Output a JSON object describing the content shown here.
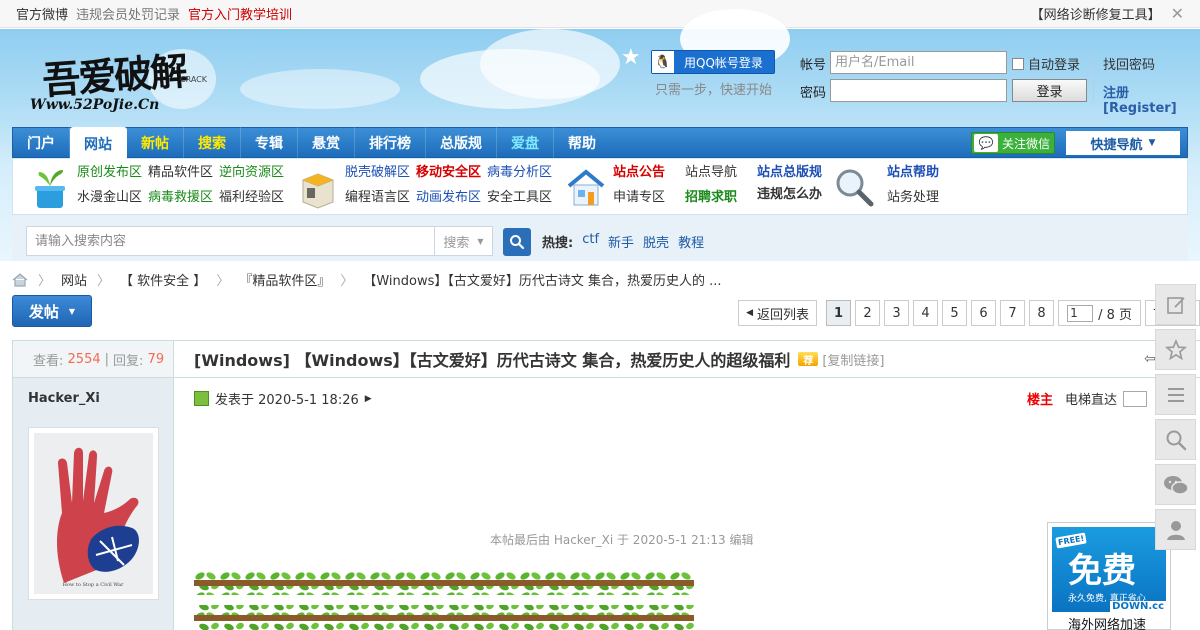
{
  "topbar": {
    "left": [
      {
        "label": "官方微博",
        "color": "dark"
      },
      {
        "label": "违规会员处罚记录",
        "color": "grey"
      },
      {
        "label": "官方入门教学培训",
        "color": "red"
      }
    ],
    "right_label": "【网络诊断修复工具】",
    "close": "✕"
  },
  "logo": {
    "big": "吾爱破解",
    "crack": "CRACK",
    "url": "Www.52PoJie.Cn"
  },
  "login": {
    "qq_button": "用QQ帐号登录",
    "qq_sub": "只需一步，快速开始",
    "account_label": "帐号",
    "account_placeholder": "用户名/Email",
    "password_label": "密码",
    "auto_login": "自动登录",
    "login_button": "登录",
    "find_password": "找回密码",
    "register": "注册[Register]"
  },
  "nav": {
    "items": [
      {
        "label": "门户",
        "style": "normal"
      },
      {
        "label": "网站",
        "style": "active"
      },
      {
        "label": "新帖",
        "style": "yellow"
      },
      {
        "label": "搜索",
        "style": "yellow"
      },
      {
        "label": "专辑",
        "style": "normal"
      },
      {
        "label": "悬赏",
        "style": "normal"
      },
      {
        "label": "排行榜",
        "style": "normal"
      },
      {
        "label": "总版规",
        "style": "normal"
      },
      {
        "label": "爱盘",
        "style": "cyan"
      },
      {
        "label": "帮助",
        "style": "normal"
      }
    ],
    "wechat": "关注微信",
    "quick_nav": "快捷导航"
  },
  "subnav": {
    "group1": [
      {
        "label": "原创发布区",
        "style": "green"
      },
      {
        "label": "精品软件区",
        "style": "normal"
      },
      {
        "label": "逆向资源区",
        "style": "green"
      },
      {
        "label": "水漫金山区",
        "style": "normal"
      },
      {
        "label": "病毒救援区",
        "style": "green"
      },
      {
        "label": "福利经验区",
        "style": "normal"
      }
    ],
    "group2": [
      {
        "label": "脱壳破解区",
        "style": "blue"
      },
      {
        "label": "移动安全区",
        "style": "red-bold"
      },
      {
        "label": "病毒分析区",
        "style": "blue"
      },
      {
        "label": "编程语言区",
        "style": "normal"
      },
      {
        "label": "动画发布区",
        "style": "blue"
      },
      {
        "label": "安全工具区",
        "style": "normal"
      }
    ],
    "group3": [
      {
        "label": "站点公告",
        "style": "red-bold"
      },
      {
        "label": "站点导航",
        "style": "normal"
      },
      {
        "label": "申请专区",
        "style": "normal"
      },
      {
        "label": "招聘求职",
        "style": "green-bold"
      }
    ],
    "group4": [
      {
        "label": "站点总版规",
        "style": "blue-bold"
      },
      {
        "label": "违规怎么办",
        "style": "dark-bold"
      }
    ],
    "group5": [
      {
        "label": "站点帮助",
        "style": "blue-bold"
      },
      {
        "label": "站务处理",
        "style": "normal"
      }
    ]
  },
  "search": {
    "placeholder": "请输入搜索内容",
    "select_value": "搜索",
    "hot_label": "热搜:",
    "hot_terms": [
      "ctf",
      "新手",
      "脱壳",
      "教程"
    ]
  },
  "breadcrumb": [
    "网站",
    "【 软件安全 】",
    "『精品软件区』",
    "【Windows】【古文爱好】历代古诗文 集合，热爱历史人的 ..."
  ],
  "post_button": "发帖",
  "pager": {
    "back_label": "返回列表",
    "pages": [
      "1",
      "2",
      "3",
      "4",
      "5",
      "6",
      "7",
      "8"
    ],
    "current": "1",
    "input_value": "1",
    "total_label": "/ 8 页",
    "next_label": "下一页"
  },
  "thread": {
    "views_label": "查看:",
    "views": "2554",
    "replies_label": "回复:",
    "replies": "79",
    "title": "[Windows] 【Windows】【古文爱好】历代古诗文 集合，热爱历史人的超级福利",
    "badge": "荐",
    "copy_link": "[复制链接]",
    "author": "Hacker_Xi",
    "avatar_caption": "How to Stop a Civil War",
    "posted_label": "发表于 2020-5-1 18:26",
    "owner_label": "楼主",
    "elevator_label": "电梯直达",
    "last_edit": "本帖最后由 Hacker_Xi 于 2020-5-1 21:13 编辑"
  },
  "ad": {
    "big": "免费",
    "free": "FREE!",
    "line": "永久免费, 真正省心",
    "brand": "DOWN.cc",
    "caption": "海外网络加速"
  }
}
